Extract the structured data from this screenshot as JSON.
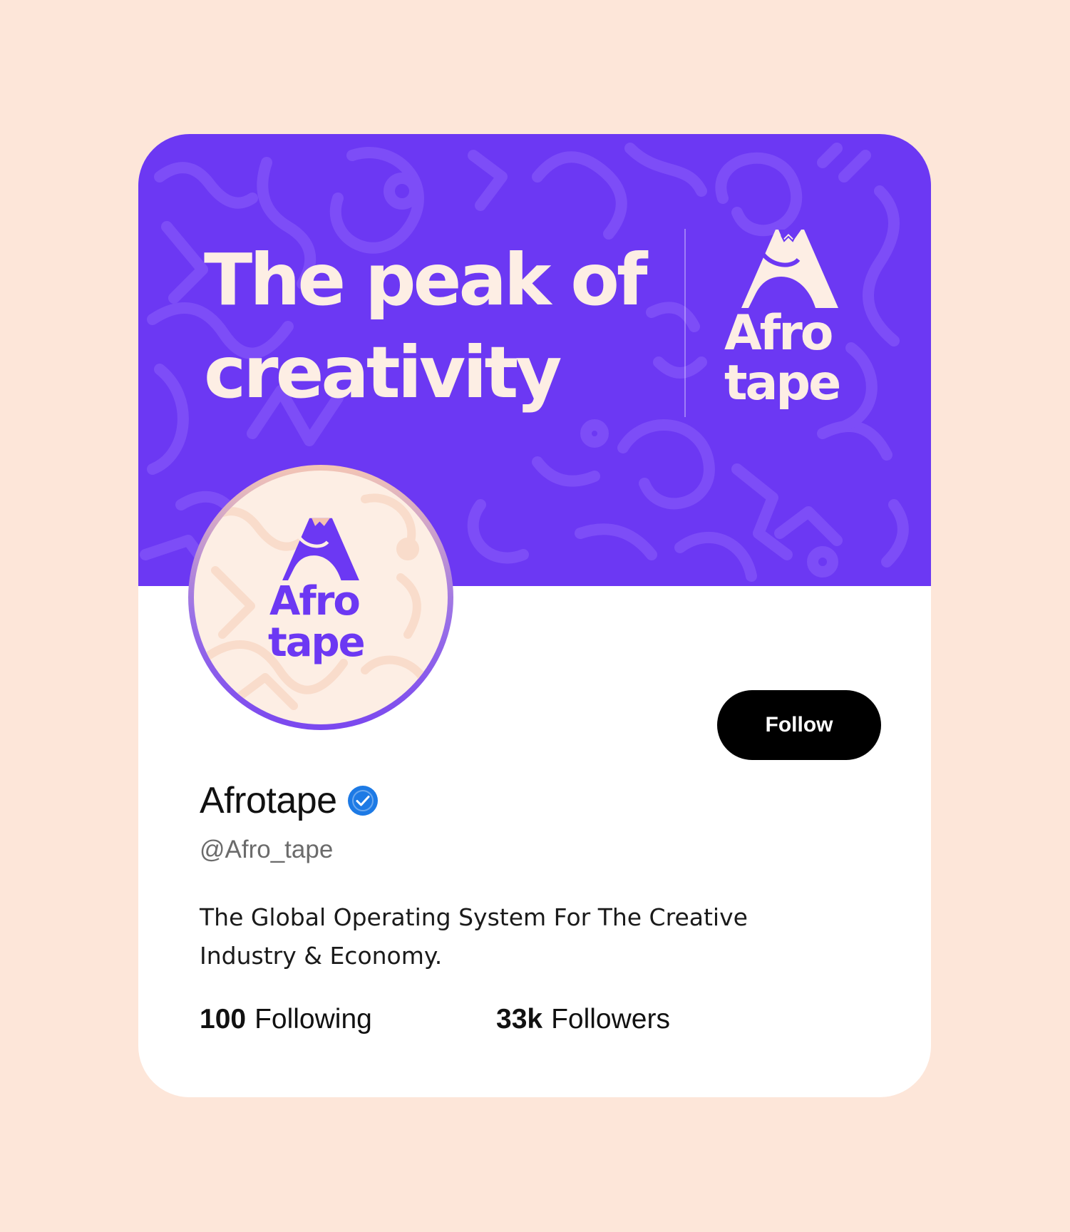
{
  "colors": {
    "page_background": "#fde6d9",
    "card_background": "#ffffff",
    "banner_purple": "#6c38f3",
    "cream_text": "#fdeee4",
    "button_black": "#000000",
    "verified_blue": "#1d7ae5"
  },
  "banner": {
    "headline_line1": "The peak of",
    "headline_line2": "creativity",
    "logo_word1": "Afro",
    "logo_word2": "tape"
  },
  "avatar": {
    "logo_word1": "Afro",
    "logo_word2": "tape"
  },
  "profile": {
    "follow_label": "Follow",
    "display_name": "Afrotape",
    "verified_icon": "verified-badge-icon",
    "handle": "@Afro_tape",
    "bio": "The Global Operating System For The Creative Industry & Economy."
  },
  "stats": {
    "following_count": "100",
    "following_label": "Following",
    "followers_count": "33k",
    "followers_label": "Followers"
  }
}
